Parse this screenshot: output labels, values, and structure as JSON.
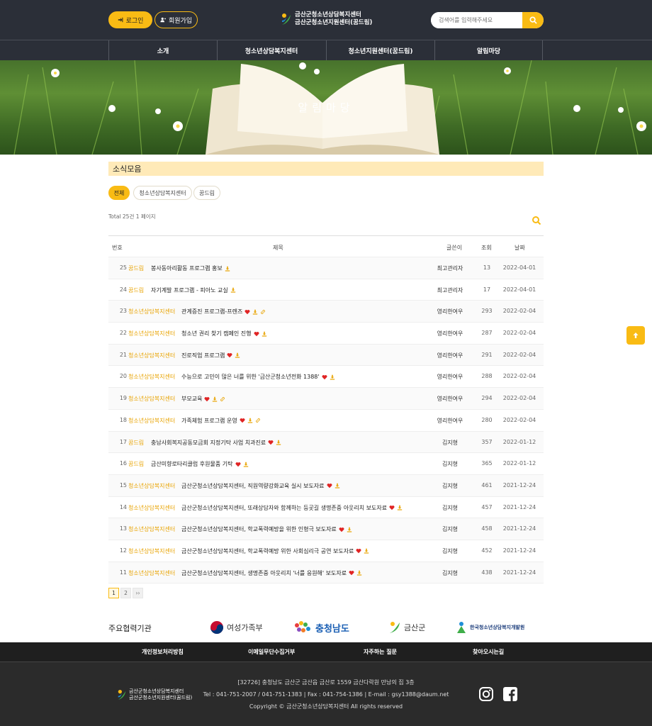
{
  "header": {
    "login_label": "로그인",
    "join_label": "회원가입",
    "logo_line1": "금산군청소년상담복지센터",
    "logo_line2": "금산군청소년지원센터(꿈드림)",
    "search_placeholder": "검색어를 입력해주세요"
  },
  "nav": [
    "소개",
    "청소년상담복지센터",
    "청소년지원센터(꿈드림)",
    "알림마당"
  ],
  "banner_title": "알림마당",
  "section_title": "소식모음",
  "category_tabs": [
    "전체",
    "청소년상담복지센터",
    "꿈드림"
  ],
  "total_text": "Total 25건 1 페이지",
  "table": {
    "headers": [
      "번호",
      "제목",
      "글쓴이",
      "조회",
      "날짜"
    ],
    "rows": [
      {
        "no": "25",
        "cat": "꿈드림",
        "title": "봉사동아리활동 프로그램 홍보",
        "heart": false,
        "file": true,
        "link": false,
        "author": "최고관리자",
        "views": "13",
        "date": "2022-04-01"
      },
      {
        "no": "24",
        "cat": "꿈드림",
        "title": "자기계발 프로그램 - 피아노 교실",
        "heart": false,
        "file": true,
        "link": false,
        "author": "최고관리자",
        "views": "17",
        "date": "2022-04-01"
      },
      {
        "no": "23",
        "cat": "청소년상담복지센터",
        "title": "관계증진 프로그램-프렌즈",
        "heart": true,
        "file": true,
        "link": true,
        "author": "영리한여우",
        "views": "293",
        "date": "2022-02-04"
      },
      {
        "no": "22",
        "cat": "청소년상담복지센터",
        "title": "청소년 권리 찾기 캠페인 진행",
        "heart": true,
        "file": true,
        "link": false,
        "author": "영리한여우",
        "views": "287",
        "date": "2022-02-04"
      },
      {
        "no": "21",
        "cat": "청소년상담복지센터",
        "title": "진로직업 프로그램",
        "heart": true,
        "file": true,
        "link": false,
        "author": "영리한여우",
        "views": "291",
        "date": "2022-02-04"
      },
      {
        "no": "20",
        "cat": "청소년상담복지센터",
        "title": "수능으로 고민이 많은 너를 위한 '금산군청소년전화 1388'",
        "heart": true,
        "file": true,
        "link": false,
        "author": "영리한여우",
        "views": "288",
        "date": "2022-02-04"
      },
      {
        "no": "19",
        "cat": "청소년상담복지센터",
        "title": "부모교육",
        "heart": true,
        "file": true,
        "link": true,
        "author": "영리한여우",
        "views": "294",
        "date": "2022-02-04"
      },
      {
        "no": "18",
        "cat": "청소년상담복지센터",
        "title": "가족체험 프로그램 운영",
        "heart": true,
        "file": true,
        "link": true,
        "author": "영리한여우",
        "views": "280",
        "date": "2022-02-04"
      },
      {
        "no": "17",
        "cat": "꿈드림",
        "title": "충남사회복지공동모금회 지정기탁 사업 치과진료",
        "heart": true,
        "file": true,
        "link": false,
        "author": "김지형",
        "views": "357",
        "date": "2022-01-12"
      },
      {
        "no": "16",
        "cat": "꿈드림",
        "title": "금산미향로타리클럽 후원물품 기탁",
        "heart": true,
        "file": true,
        "link": false,
        "author": "김지형",
        "views": "365",
        "date": "2022-01-12"
      },
      {
        "no": "15",
        "cat": "청소년상담복지센터",
        "title": "금산군청소년상담복지센터, 직원역량강화교육 실시 보도자료",
        "heart": true,
        "file": true,
        "link": false,
        "author": "김지형",
        "views": "461",
        "date": "2021-12-24"
      },
      {
        "no": "14",
        "cat": "청소년상담복지센터",
        "title": "금산군청소년상담복지센터, 또래상담자와 함께하는 등굣길 생명존중 아웃리치 보도자료",
        "heart": true,
        "file": true,
        "link": false,
        "author": "김지형",
        "views": "457",
        "date": "2021-12-24"
      },
      {
        "no": "13",
        "cat": "청소년상담복지센터",
        "title": "금산군청소년상담복지센터, 학교폭력예방을 위한 인형극 보도자료",
        "heart": true,
        "file": true,
        "link": false,
        "author": "김지형",
        "views": "458",
        "date": "2021-12-24"
      },
      {
        "no": "12",
        "cat": "청소년상담복지센터",
        "title": "금산군청소년상담복지센터, 학교폭력예방 위한 사회심리극 공연 보도자료",
        "heart": true,
        "file": true,
        "link": false,
        "author": "김지형",
        "views": "452",
        "date": "2021-12-24"
      },
      {
        "no": "11",
        "cat": "청소년상담복지센터",
        "title": "금산군청소년상담복지센터, 생명존중 아웃리치 '너를 응원해' 보도자료",
        "heart": true,
        "file": true,
        "link": false,
        "author": "김지형",
        "views": "438",
        "date": "2021-12-24"
      }
    ]
  },
  "pagination": [
    "1",
    "2",
    "››"
  ],
  "partners_label": "주요협력기관",
  "partners": [
    "여성가족부",
    "충청남도",
    "금산군",
    "한국청소년상담복지개발원"
  ],
  "footer_links": [
    "개인정보처리방침",
    "이메일무단수집거부",
    "자주하는 질문",
    "찾아오시는길"
  ],
  "footer": {
    "logo_line1": "금산군청소년상담복지센터",
    "logo_line2": "금산군청소년지원센터(꿈드림)",
    "address": "[32726] 충청남도 금산군 금산읍 금산로 1559 금산다락원 만남의 집 3층",
    "contact": "Tel : 041-751-2007 / 041-751-1383 | Fax : 041-754-1386 | E-mail : gsy1388@daum.net",
    "copyright": "Copyright © 금산군청소년상담복지센터 All rights reserved"
  },
  "colors": {
    "accent": "#f9bb14",
    "header_bg": "#2b2f38",
    "section_bg": "#ffeab8",
    "heart": "#e02424"
  }
}
